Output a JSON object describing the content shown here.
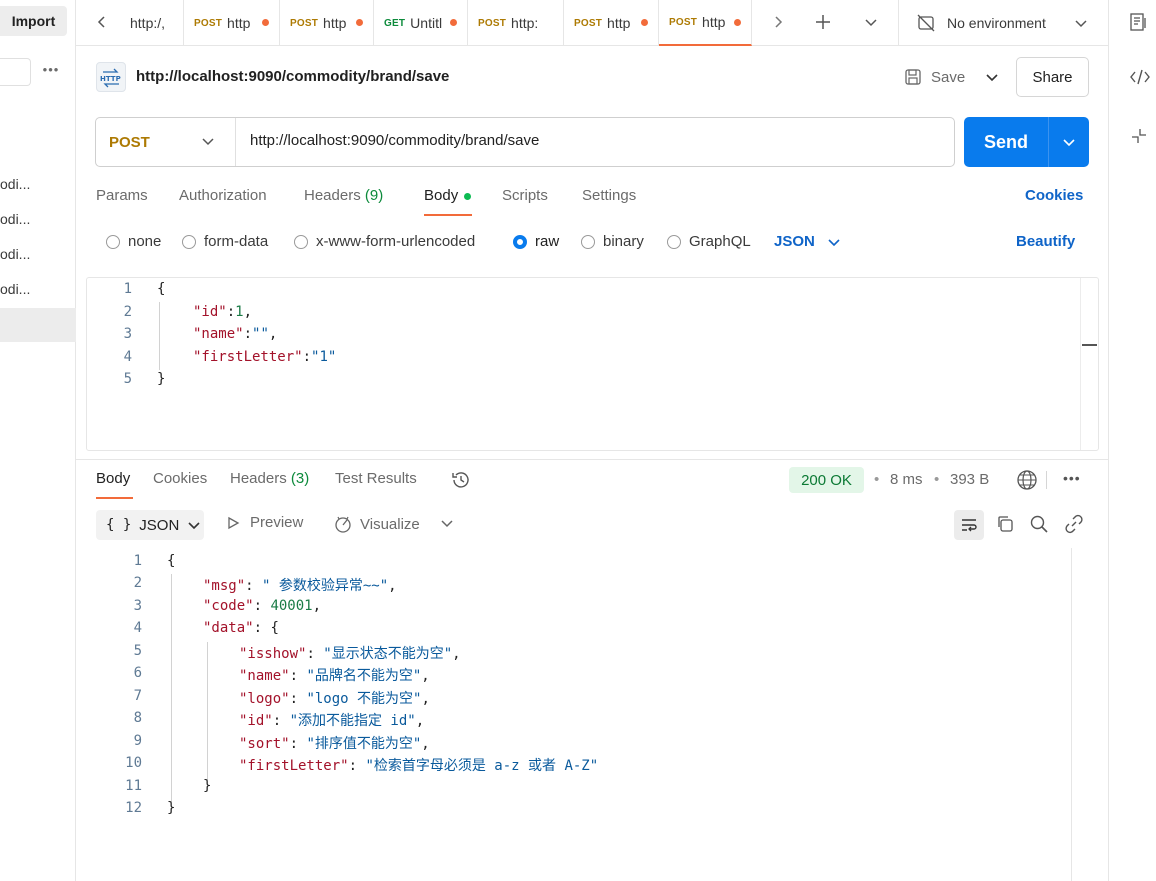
{
  "sidebar": {
    "import_label": "Import",
    "more_label": "•••",
    "items": [
      "odi...",
      "odi...",
      "odi...",
      "odi..."
    ]
  },
  "tabs": [
    {
      "method": "",
      "title": "http:/,",
      "dirty": false
    },
    {
      "method": "POST",
      "title": "http",
      "dirty": true
    },
    {
      "method": "POST",
      "title": "http",
      "dirty": true
    },
    {
      "method": "GET",
      "title": "Untitl",
      "dirty": true
    },
    {
      "method": "POST",
      "title": "http:",
      "dirty": false
    },
    {
      "method": "POST",
      "title": "http",
      "dirty": true
    },
    {
      "method": "POST",
      "title": "http",
      "dirty": true,
      "active": true
    }
  ],
  "environment": {
    "label": "No environment"
  },
  "request": {
    "title": "http://localhost:9090/commodity/brand/save",
    "save_label": "Save",
    "share_label": "Share",
    "method": "POST",
    "url": "http://localhost:9090/commodity/brand/save",
    "send_label": "Send",
    "tabs": {
      "params": "Params",
      "authorization": "Authorization",
      "headers": "Headers",
      "headers_count": "(9)",
      "body": "Body",
      "scripts": "Scripts",
      "settings": "Settings"
    },
    "cookies_label": "Cookies",
    "body_types": [
      "none",
      "form-data",
      "x-www-form-urlencoded",
      "raw",
      "binary",
      "GraphQL"
    ],
    "selected_body_type": "raw",
    "format_label": "JSON",
    "beautify_label": "Beautify",
    "body_lines": [
      {
        "n": "1",
        "text": "{"
      },
      {
        "n": "2",
        "key": "\"id\"",
        "sep": ":",
        "num": "1",
        "end": ","
      },
      {
        "n": "3",
        "key": "\"name\"",
        "sep": ":",
        "str": "\"\"",
        "end": ","
      },
      {
        "n": "4",
        "key": "\"firstLetter\"",
        "sep": ":",
        "str": "\"1\"",
        "end": ""
      },
      {
        "n": "5",
        "text": "}"
      }
    ]
  },
  "response": {
    "tabs": {
      "body": "Body",
      "cookies": "Cookies",
      "headers": "Headers",
      "headers_count": "(3)",
      "test_results": "Test Results"
    },
    "status": "200 OK",
    "time": "8 ms",
    "size": "393 B",
    "more_label": "•••",
    "format_label": "JSON",
    "format_prefix": "{ }",
    "preview_label": "Preview",
    "visualize_label": "Visualize",
    "lines": [
      {
        "n": "1",
        "indent": 0,
        "text": "{"
      },
      {
        "n": "2",
        "indent": 1,
        "key": "\"msg\"",
        "str": "\" 参数校验异常~~\"",
        "end": ","
      },
      {
        "n": "3",
        "indent": 1,
        "key": "\"code\"",
        "num": "40001",
        "end": ","
      },
      {
        "n": "4",
        "indent": 1,
        "key": "\"data\"",
        "text_after": "{"
      },
      {
        "n": "5",
        "indent": 2,
        "key": "\"isshow\"",
        "str": "\"显示状态不能为空\"",
        "end": ","
      },
      {
        "n": "6",
        "indent": 2,
        "key": "\"name\"",
        "str": "\"品牌名不能为空\"",
        "end": ","
      },
      {
        "n": "7",
        "indent": 2,
        "key": "\"logo\"",
        "str": "\"logo 不能为空\"",
        "end": ","
      },
      {
        "n": "8",
        "indent": 2,
        "key": "\"id\"",
        "str": "\"添加不能指定 id\"",
        "end": ","
      },
      {
        "n": "9",
        "indent": 2,
        "key": "\"sort\"",
        "str": "\"排序值不能为空\"",
        "end": ","
      },
      {
        "n": "10",
        "indent": 2,
        "key": "\"firstLetter\"",
        "str": "\"检索首字母必须是 a-z 或者 A-Z\"",
        "end": ""
      },
      {
        "n": "11",
        "indent": 1,
        "text": "}"
      },
      {
        "n": "12",
        "indent": 0,
        "text": "}"
      }
    ]
  },
  "colors": {
    "accent": "#f26b3a",
    "send": "#097bed",
    "link": "#0f64c8",
    "post": "#ad7a03",
    "get": "#0c8a3b",
    "status_bg": "#e3f6e8"
  }
}
